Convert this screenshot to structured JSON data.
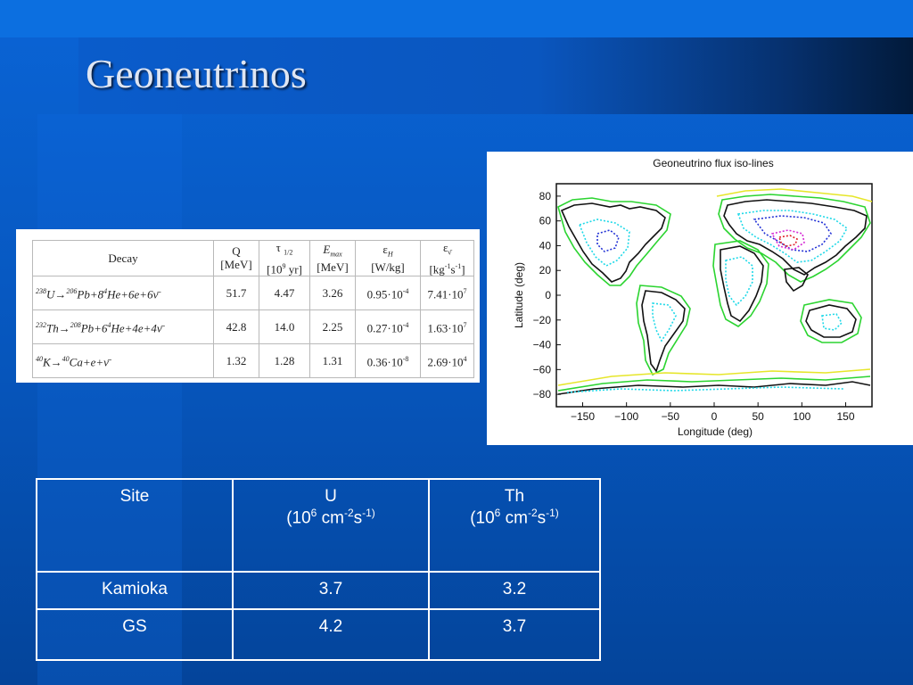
{
  "title": "Geoneutrinos",
  "decay_table": {
    "headers": {
      "decay": "Decay",
      "q": "Q",
      "q_unit": "[MeV]",
      "tau": "τ",
      "tau_sub": "1/2",
      "tau_unit_a": "[10",
      "tau_unit_sup": "9",
      "tau_unit_b": " yr]",
      "emax": "E",
      "emax_sub": "max",
      "emax_unit": "[MeV]",
      "eh": "ε",
      "eh_sub": "H",
      "eh_unit": "[W/kg]",
      "ev": "ε",
      "ev_sub": "ν̄",
      "ev_unit_a": "[kg",
      "ev_unit_sup1": "-1",
      "ev_unit_b": "s",
      "ev_unit_sup2": "-1",
      "ev_unit_c": "]"
    },
    "rows": [
      {
        "eq": {
          "a": "238",
          "b": "U→",
          "c": "206",
          "d": "Pb+8",
          "e": "4",
          "f": "He+6e+6ν̄"
        },
        "q": "51.7",
        "tau": "4.47",
        "emax": "3.26",
        "eh_a": "0.95·10",
        "eh_exp": "-4",
        "ev_a": "7.41·10",
        "ev_exp": "7"
      },
      {
        "eq": {
          "a": "232",
          "b": "Th→",
          "c": "208",
          "d": "Pb+6",
          "e": "4",
          "f": "He+4e+4ν̄"
        },
        "q": "42.8",
        "tau": "14.0",
        "emax": "2.25",
        "eh_a": "0.27·10",
        "eh_exp": "-4",
        "ev_a": "1.63·10",
        "ev_exp": "7"
      },
      {
        "eq": {
          "a": "40",
          "b": "K→",
          "c": "40",
          "d": "Ca+e+ν̄",
          "e": "",
          "f": ""
        },
        "q": "1.32",
        "tau": "1.28",
        "emax": "1.31",
        "eh_a": "0.36·10",
        "eh_exp": "-8",
        "ev_a": "2.69·10",
        "ev_exp": "4"
      }
    ]
  },
  "map": {
    "title": "Geoneutrino flux iso-lines",
    "xlabel": "Longitude (deg)",
    "ylabel": "Latitude (deg)",
    "xticks": [
      "−150",
      "−100",
      "−50",
      "0",
      "50",
      "100",
      "150"
    ],
    "yticks": [
      "80",
      "60",
      "40",
      "20",
      "0",
      "−20",
      "−40",
      "−60",
      "−80"
    ]
  },
  "flux_table": {
    "headers": {
      "site": "Site",
      "u": "U",
      "th": "Th",
      "unit_a": "(10",
      "unit_sup1": "6",
      "unit_b": " cm",
      "unit_sup2": "-2",
      "unit_c": "s",
      "unit_sup3": "-1)"
    },
    "rows": [
      {
        "site": "Kamioka",
        "u": "3.7",
        "th": "3.2"
      },
      {
        "site": "GS",
        "u": "4.2",
        "th": "3.7"
      }
    ]
  }
}
